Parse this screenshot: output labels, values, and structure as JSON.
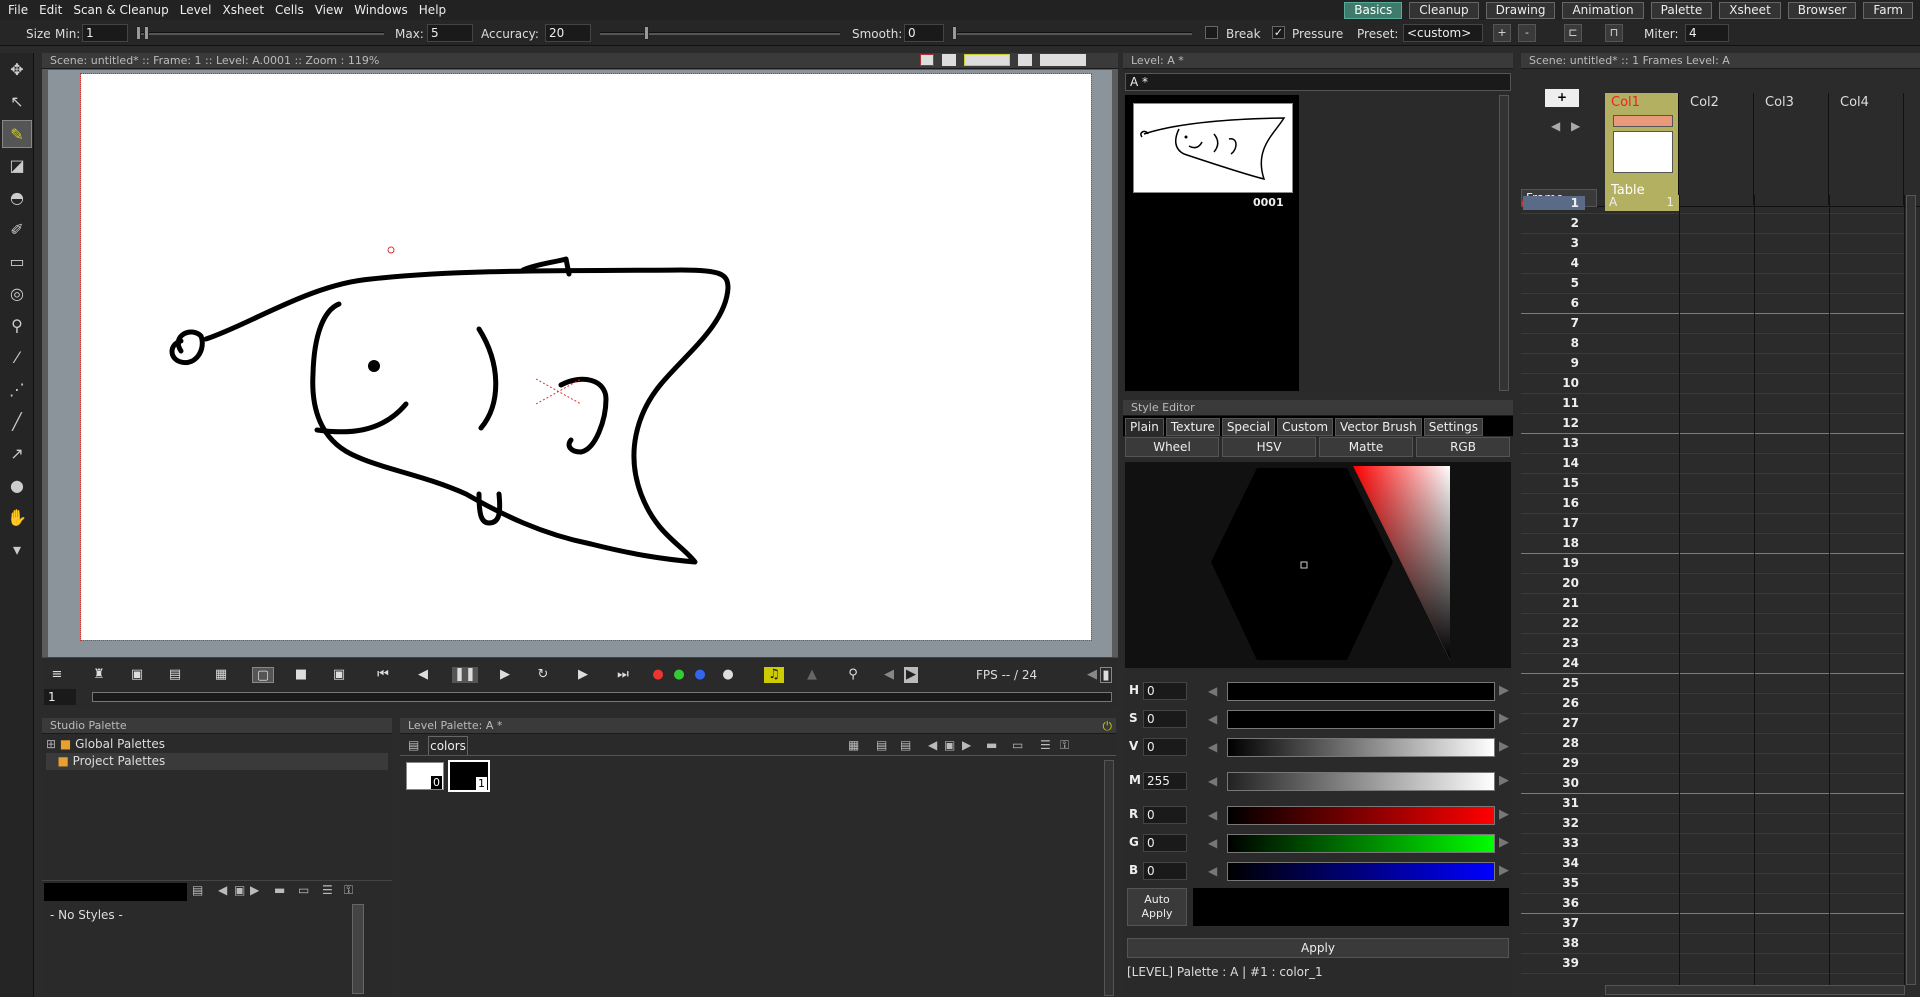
{
  "menu": [
    "File",
    "Edit",
    "Scan & Cleanup",
    "Level",
    "Xsheet",
    "Cells",
    "View",
    "Windows",
    "Help"
  ],
  "rooms": [
    {
      "label": "Basics",
      "active": true
    },
    {
      "label": "Cleanup"
    },
    {
      "label": "Drawing"
    },
    {
      "label": "Animation"
    },
    {
      "label": "Palette"
    },
    {
      "label": "Xsheet"
    },
    {
      "label": "Browser"
    },
    {
      "label": "Farm"
    }
  ],
  "tool_options": {
    "size_label": "Size",
    "min_label": "Min:",
    "min": "1",
    "max_label": "Max:",
    "max": "5",
    "accuracy_label": "Accuracy:",
    "accuracy": "20",
    "smooth_label": "Smooth:",
    "smooth": "0",
    "break_label": "Break",
    "break_checked": false,
    "pressure_label": "Pressure",
    "pressure_checked": true,
    "preset_label": "Preset:",
    "preset": "<custom>",
    "plus": "+",
    "minus": "-",
    "miter_label": "Miter:",
    "miter": "4"
  },
  "viewer": {
    "title": "Scene: untitled*  ::  Frame: 1  ::  Level: A.0001  ::  Zoom : 119%",
    "frame_field": "1",
    "fps_label": "FPS -- / 24"
  },
  "studio_palette": {
    "title": "Studio Palette",
    "tree": [
      "Global Palettes",
      "Project Palettes"
    ],
    "empty": "- No Styles -"
  },
  "level_palette": {
    "title": "Level Palette: A *",
    "tab": "colors",
    "chips": [
      {
        "index": "0",
        "color": "#ffffff"
      },
      {
        "index": "1",
        "color": "#000000"
      }
    ]
  },
  "level_strip": {
    "title": "Level:  A *",
    "dropdown": "A *",
    "frame_label": "0001"
  },
  "style_editor": {
    "title": "Style Editor",
    "tabs": [
      "Plain",
      "Texture",
      "Special",
      "Custom",
      "Vector Brush",
      "Settings"
    ],
    "modes": [
      "Wheel",
      "HSV",
      "Matte",
      "RGB"
    ],
    "channels": [
      {
        "name": "H",
        "value": "0"
      },
      {
        "name": "S",
        "value": "0"
      },
      {
        "name": "V",
        "value": "0"
      },
      {
        "name": "M",
        "value": "255"
      },
      {
        "name": "R",
        "value": "0"
      },
      {
        "name": "G",
        "value": "0"
      },
      {
        "name": "B",
        "value": "0"
      }
    ],
    "auto_apply": "Auto Apply",
    "apply": "Apply",
    "status": "[LEVEL]   Palette : A | #1 : color_1"
  },
  "xsheet": {
    "title": "Scene: untitled*  ::   1 Frames  Level: A",
    "frame_label": "Frame",
    "columns": [
      "Col1",
      "Col2",
      "Col3",
      "Col4"
    ],
    "table_label": "Table",
    "cell_level": "A",
    "cell_frame": "1",
    "rows": [
      "1",
      "2",
      "3",
      "4",
      "5",
      "6",
      "7",
      "8",
      "9",
      "10",
      "11",
      "12",
      "13",
      "14",
      "15",
      "16",
      "17",
      "18",
      "19",
      "20",
      "21",
      "22",
      "23",
      "24",
      "25",
      "26",
      "27",
      "28",
      "29",
      "30",
      "31",
      "32",
      "33",
      "34",
      "35",
      "36",
      "37",
      "38",
      "39"
    ]
  }
}
